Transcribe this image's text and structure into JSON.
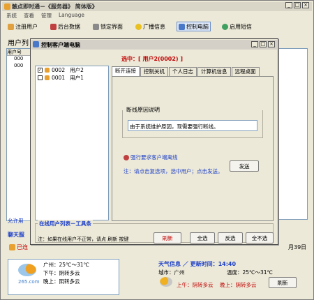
{
  "app": {
    "title": "触点即时通－《服务器》 简体版》",
    "menu": [
      "系统",
      "查看",
      "管理",
      "Language"
    ],
    "toolbar": [
      {
        "label": "注册用户",
        "icon": "register-user-icon"
      },
      {
        "label": "后台数据",
        "icon": "database-icon"
      },
      {
        "label": "锁定界面",
        "icon": "lock-icon"
      },
      {
        "label": "广播信息",
        "icon": "broadcast-icon"
      },
      {
        "label": "控制电脑",
        "icon": "computer-icon"
      },
      {
        "label": "启用短信",
        "icon": "sms-icon"
      }
    ],
    "user_panel_title": "用户列",
    "user_panel_header": "用户号",
    "user_rows": [
      "000",
      "000"
    ],
    "allow_text": "允许用",
    "chat_label": "聊天服",
    "chat_text": "已连",
    "date_text": "月39日"
  },
  "dialog": {
    "title": "控制客户端电脑",
    "selected": "选中：[   用户2(0002)   ]",
    "users": [
      {
        "id": "0002",
        "name": "用户2",
        "checked": true
      },
      {
        "id": "0001",
        "name": "用户1",
        "checked": false
      }
    ],
    "tabs": [
      "断开连接",
      "控制关机",
      "个人日志",
      "计算机信息",
      "远程桌面"
    ],
    "reason_label": "断线原因说明",
    "reason_value": "由于系统维护原因，现需要强行断线。",
    "require_text": "强行要求客户端离线",
    "note_text": "注：请点击复选项，选中用户；点击发送。",
    "send_button": "发送",
    "toolbox_title": "在线用户列表－工具条",
    "toolbox_note": "注：如果在线用户不正常，请点 刷新 按键",
    "refresh_button": "刷新",
    "select_all_button": "全选",
    "invert_button": "反选",
    "deselect_button": "全不选"
  },
  "weather": {
    "city_line1": "广州：25℃～31℃",
    "line2": "下午：阴转多云",
    "line3": "晚上：阴转多云",
    "logo_text": "265.com",
    "header": "天气信息 ／ 更新时间：14:40",
    "city": "城市：广州",
    "temp": "温度：25℃～31℃",
    "afternoon": "上午：阴转多云",
    "evening": "晚上：阴转多云",
    "refresh_button": "刷新"
  },
  "colors": {
    "accent_red": "#c00000",
    "accent_blue": "#1c3fc8",
    "window_bg": "#ece9d8"
  }
}
